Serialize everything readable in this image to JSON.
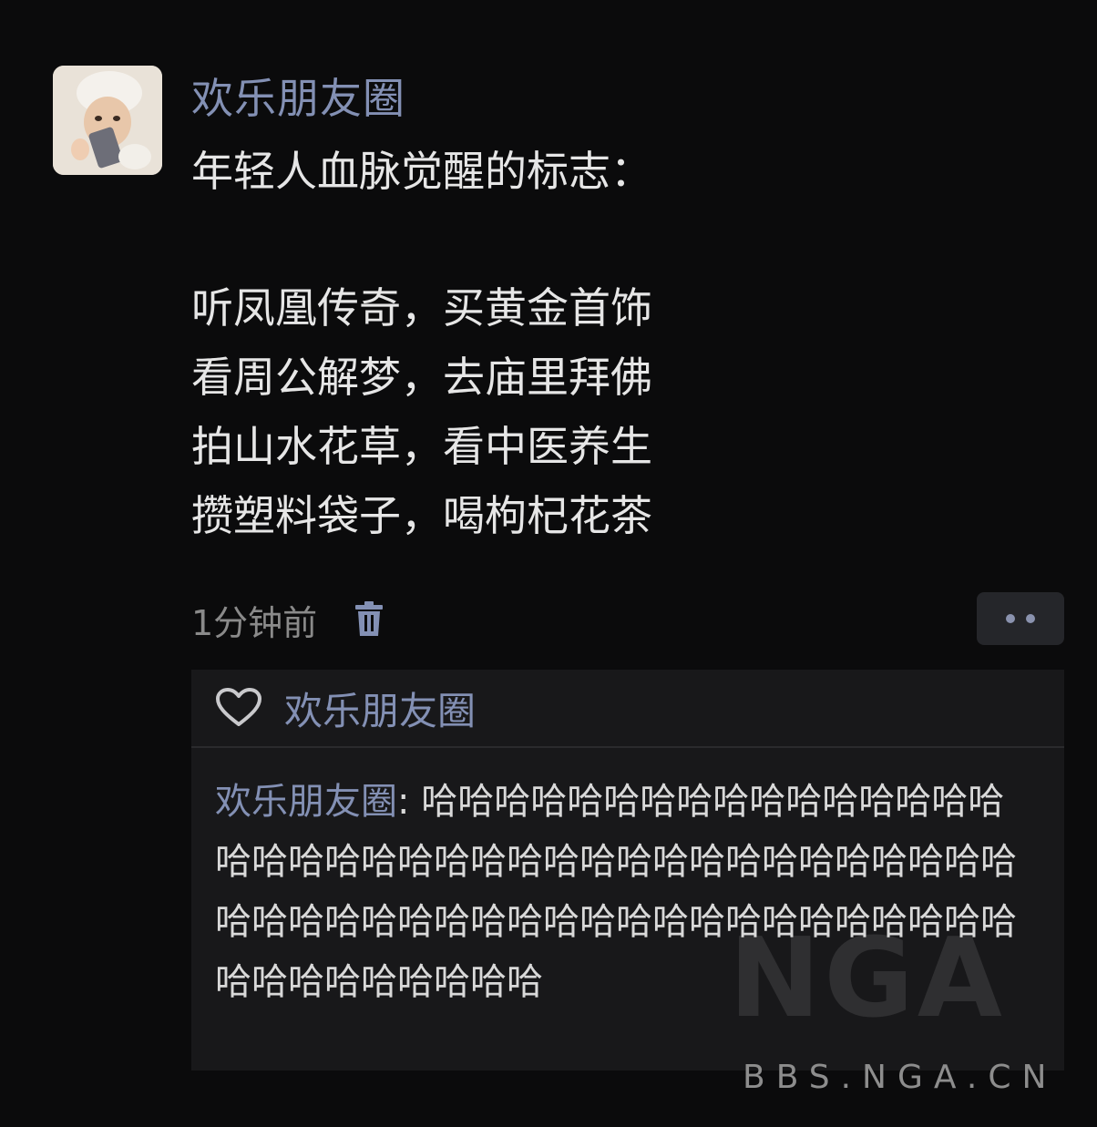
{
  "post": {
    "author": "欢乐朋友圈",
    "avatar_icon": "baby-avatar",
    "title_line": "年轻人血脉觉醒的标志：",
    "lines": [
      "听凤凰传奇，买黄金首饰",
      "看周公解梦，去庙里拜佛",
      "拍山水花草，看中医养生",
      "攒塑料袋子，喝枸杞花茶"
    ],
    "time": "1分钟前",
    "delete_icon": "trash-icon",
    "more_icon": "two-dots-icon"
  },
  "likes": {
    "icon": "heart-icon",
    "names": "欢乐朋友圈"
  },
  "comment": {
    "author": "欢乐朋友圈",
    "separator": ": ",
    "text": "哈哈哈哈哈哈哈哈哈哈哈哈哈哈哈哈哈哈哈哈哈哈哈哈哈哈哈哈哈哈哈哈哈哈哈哈哈哈哈哈哈哈哈哈哈哈哈哈哈哈哈哈哈哈哈哈哈哈哈哈哈哈哈哈哈哈哈哈哈"
  },
  "watermark": {
    "logo": "NGA",
    "url": "BBS.NGA.CN"
  },
  "colors": {
    "background": "#0b0b0c",
    "name": "#8390b4",
    "text": "#e6e6e6",
    "box": "#18181a"
  }
}
